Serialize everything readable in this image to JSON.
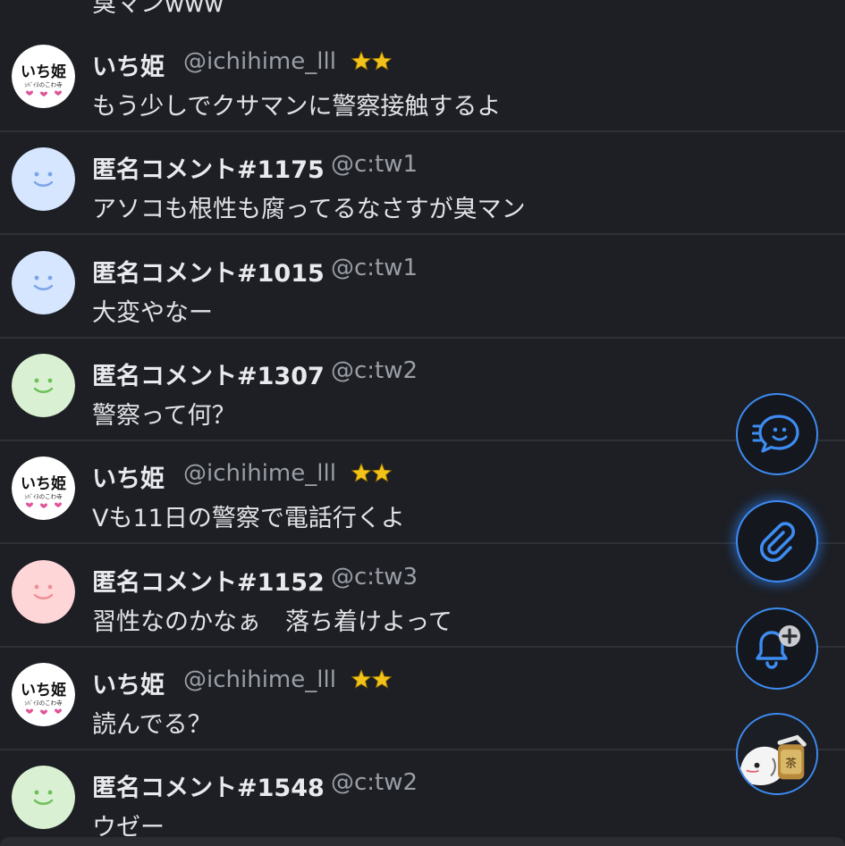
{
  "partial_top": {
    "text": "臭マンwww"
  },
  "comments": [
    {
      "avatar": "ichihime",
      "username": "いち姫",
      "handle": "@ichihime_lll",
      "badge": "double-star-badge",
      "text": "もう少しでクサマンに警察接触するよ"
    },
    {
      "avatar": "blue",
      "username": "匿名コメント#1175",
      "handle": "@c:tw1",
      "text": "アソコも根性も腐ってるなさすが臭マン"
    },
    {
      "avatar": "blue",
      "username": "匿名コメント#1015",
      "handle": "@c:tw1",
      "text": "大変やなー"
    },
    {
      "avatar": "green",
      "username": "匿名コメント#1307",
      "handle": "@c:tw2",
      "text": "警察って何？"
    },
    {
      "avatar": "ichihime",
      "username": "いち姫",
      "handle": "@ichihime_lll",
      "badge": "double-star-badge",
      "text": "Vも11日の警察で電話行くよ"
    },
    {
      "avatar": "pink",
      "username": "匿名コメント#1152",
      "handle": "@c:tw3",
      "text": "習性なのかなぁ　落ち着けよって"
    },
    {
      "avatar": "ichihime",
      "username": "いち姫",
      "handle": "@ichihime_lll",
      "badge": "double-star-badge",
      "text": "読んでる？"
    },
    {
      "avatar": "green",
      "username": "匿名コメント#1548",
      "handle": "@c:tw2",
      "text": "ウゼー"
    }
  ],
  "ichihime_logo": {
    "line1": "いち姫",
    "line2": "ｼﾊﾞｲﾇのこわ寺"
  },
  "fabs": [
    {
      "name": "comment-fab",
      "icon": "chat-bubble-icon"
    },
    {
      "name": "attach-fab",
      "icon": "paperclip-icon"
    },
    {
      "name": "notify-fab",
      "icon": "bell-plus-icon"
    },
    {
      "name": "profile-fab",
      "icon": "character-avatar"
    }
  ],
  "colors": {
    "background": "#1d1f24",
    "accent": "#3d8cf2",
    "avatar_blue": "#d6e6ff",
    "avatar_green": "#d9f1d2",
    "avatar_pink": "#ffd6d8",
    "star": "#f3c21a"
  }
}
